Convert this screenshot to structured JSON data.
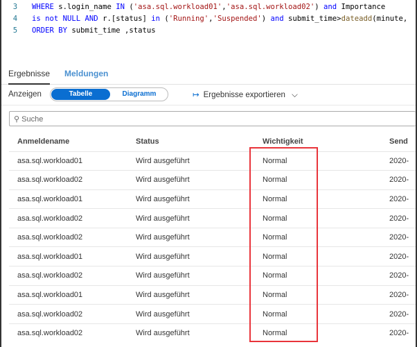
{
  "code": {
    "lines": [
      {
        "num": "3",
        "tokens": [
          [
            "kw",
            "WHERE "
          ],
          [
            "tx",
            "s.login_name "
          ],
          [
            "kw",
            "IN "
          ],
          [
            "tx",
            "("
          ],
          [
            "st",
            "'asa.sql.workload01'"
          ],
          [
            "tx",
            ","
          ],
          [
            "st",
            "'asa.sql.workload02'"
          ],
          [
            "tx",
            ") "
          ],
          [
            "kw",
            "and "
          ],
          [
            "tx",
            "Importance"
          ]
        ]
      },
      {
        "num": "4",
        "tokens": [
          [
            "kw",
            "is not NULL AND "
          ],
          [
            "tx",
            "r.[status] "
          ],
          [
            "kw",
            "in "
          ],
          [
            "tx",
            "("
          ],
          [
            "st",
            "'Running'"
          ],
          [
            "tx",
            ","
          ],
          [
            "st",
            "'Suspended'"
          ],
          [
            "tx",
            ") "
          ],
          [
            "kw",
            "and "
          ],
          [
            "tx",
            "submit_time>"
          ],
          [
            "fn",
            "dateadd"
          ],
          [
            "tx",
            "(minute,"
          ]
        ]
      },
      {
        "num": "5",
        "tokens": [
          [
            "kw",
            "ORDER BY "
          ],
          [
            "tx",
            "submit_time ,status"
          ]
        ]
      }
    ]
  },
  "tabs": {
    "results": "Ergebnisse",
    "messages": "Meldungen"
  },
  "toolbar": {
    "view_label": "Anzeigen",
    "table": "Tabelle",
    "chart": "Diagramm",
    "export": "Ergebnisse exportieren"
  },
  "search": {
    "placeholder": "Suche"
  },
  "table": {
    "columns": [
      "Anmeldename",
      "Status",
      "Wichtigkeit",
      "Send"
    ],
    "rows": [
      [
        "asa.sql.workload01",
        "Wird ausgeführt",
        "Normal",
        "2020-"
      ],
      [
        "asa.sql.workload02",
        "Wird ausgeführt",
        "Normal",
        "2020-"
      ],
      [
        "asa.sql.workload01",
        "Wird ausgeführt",
        "Normal",
        "2020-"
      ],
      [
        "asa.sql.workload02",
        "Wird ausgeführt",
        "Normal",
        "2020-"
      ],
      [
        "asa.sql.workload02",
        "Wird ausgeführt",
        "Normal",
        "2020-"
      ],
      [
        "asa.sql.workload01",
        "Wird ausgeführt",
        "Normal",
        "2020-"
      ],
      [
        "asa.sql.workload02",
        "Wird ausgeführt",
        "Normal",
        "2020-"
      ],
      [
        "asa.sql.workload01",
        "Wird ausgeführt",
        "Normal",
        "2020-"
      ],
      [
        "asa.sql.workload02",
        "Wird ausgeführt",
        "Normal",
        "2020-"
      ],
      [
        "asa.sql.workload02",
        "Wird ausgeführt",
        "Normal",
        "2020-"
      ]
    ]
  },
  "colors": {
    "accent": "#0a6ed1",
    "highlight": "#e8333a"
  }
}
